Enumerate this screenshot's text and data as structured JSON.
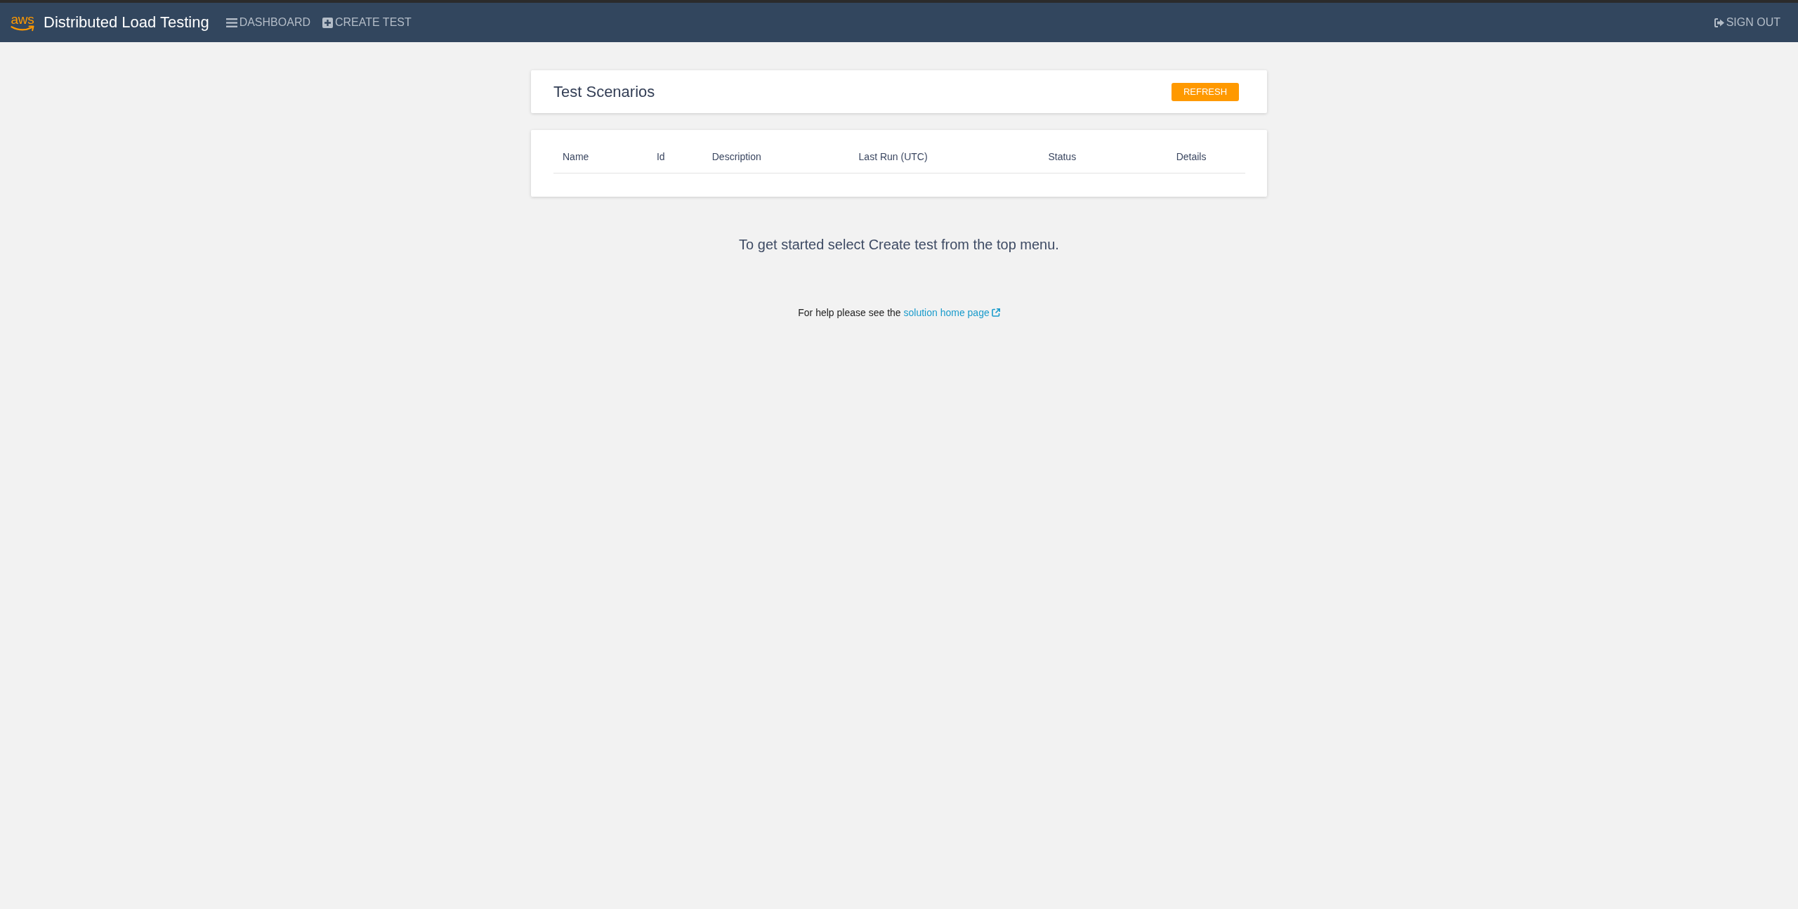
{
  "navbar": {
    "logo": "aws",
    "brand": "Distributed Load Testing",
    "links": [
      {
        "label": "DASHBOARD"
      },
      {
        "label": "CREATE TEST"
      }
    ],
    "sign_out": "SIGN OUT"
  },
  "scenarios_card": {
    "title": "Test Scenarios",
    "refresh_button": "REFRESH"
  },
  "table": {
    "columns": [
      "Name",
      "Id",
      "Description",
      "Last Run (UTC)",
      "Status",
      "Details"
    ]
  },
  "message": "To get started select Create test from the top menu.",
  "help": {
    "text": "For help please see the",
    "link": "solution home page"
  }
}
